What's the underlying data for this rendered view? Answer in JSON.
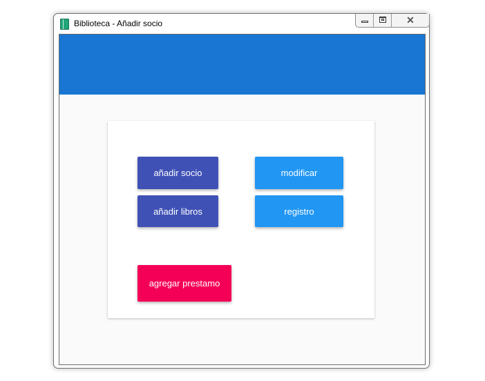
{
  "window": {
    "title": "Biblioteca - Añadir socio",
    "icon": "book-icon"
  },
  "colors": {
    "toolbar": "#1976d2",
    "primary_button": "#3f51b5",
    "secondary_button": "#2196f3",
    "accent_button": "#f50057",
    "content_background": "#fafafa"
  },
  "buttons": {
    "add_member": "añadir socio",
    "add_books": "añadir libros",
    "modify": "modificar",
    "records": "registro",
    "add_loan": "agregar prestamo"
  }
}
